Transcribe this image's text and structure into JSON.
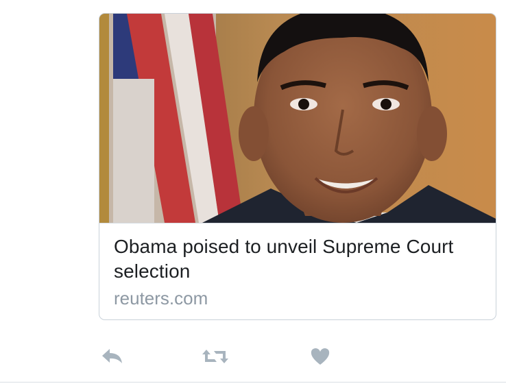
{
  "tweet_card": {
    "headline": "Obama poised to unveil Supreme Court selection",
    "domain": "reuters.com",
    "image": "portrait-photo"
  },
  "actions": {
    "reply": "reply-icon",
    "retweet": "retweet-icon",
    "like": "heart-icon"
  },
  "colors": {
    "headline": "#1c1f22",
    "domain": "#8d98a3",
    "icon": "#a8b4be",
    "border": "#c9d1d9"
  }
}
